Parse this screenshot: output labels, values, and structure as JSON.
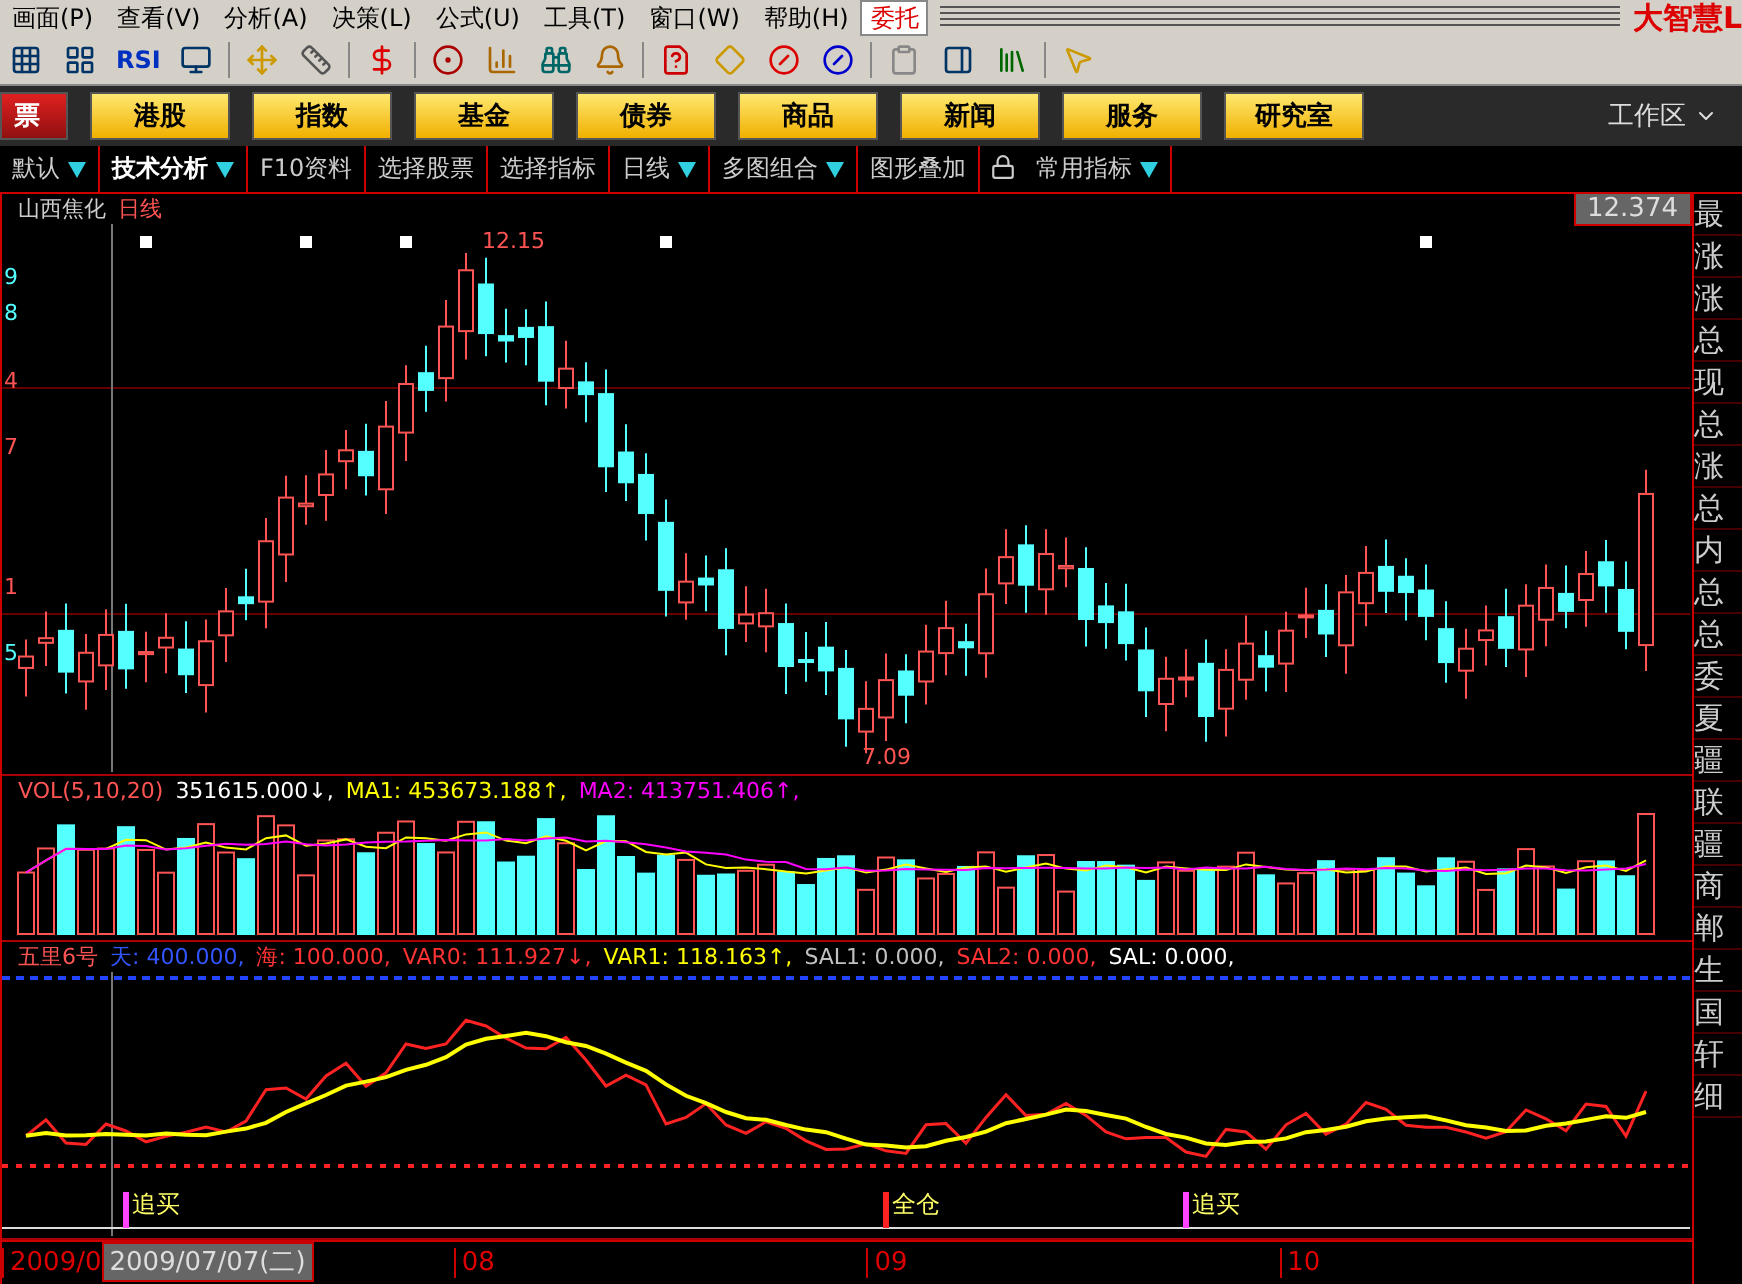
{
  "menu_bar": {
    "items": [
      "画面(P)",
      "查看(V)",
      "分析(A)",
      "决策(L)",
      "公式(U)",
      "工具(T)",
      "窗口(W)",
      "帮助(H)"
    ],
    "trade_button": "委托",
    "logo": "大智慧L"
  },
  "toolbar": {
    "rsi_label": "RSI"
  },
  "market_buttons": [
    {
      "label": "票",
      "kind": "red"
    },
    {
      "label": "港股",
      "kind": "yellow"
    },
    {
      "label": "指数",
      "kind": "yellow"
    },
    {
      "label": "基金",
      "kind": "yellow"
    },
    {
      "label": "债券",
      "kind": "yellow"
    },
    {
      "label": "商品",
      "kind": "yellow"
    },
    {
      "label": "新闻",
      "kind": "yellow"
    },
    {
      "label": "服务",
      "kind": "yellow"
    },
    {
      "label": "研究室",
      "kind": "yellow"
    }
  ],
  "workspace": {
    "label": "工作区"
  },
  "tabs": [
    {
      "label": "默认",
      "selected": false,
      "has_menu": true
    },
    {
      "label": "技术分析",
      "selected": true,
      "has_menu": true
    },
    {
      "label": "F10资料",
      "selected": false,
      "has_menu": false
    },
    {
      "label": "选择股票",
      "selected": false,
      "has_menu": false
    },
    {
      "label": "选择指标",
      "selected": false,
      "has_menu": false
    },
    {
      "label": "日线",
      "selected": false,
      "has_menu": true
    },
    {
      "label": "多图组合",
      "selected": false,
      "has_menu": true
    },
    {
      "label": "图形叠加",
      "selected": false,
      "has_menu": false
    },
    {
      "label": "常用指标",
      "selected": false,
      "has_menu": true
    }
  ],
  "price_chart": {
    "stock": "山西焦化",
    "period": "日线",
    "high_label": "12.15",
    "low_label": "7.09",
    "price_box": "12.374",
    "axis_labels": [
      {
        "text": "9",
        "color": "#54ffff"
      },
      {
        "text": "8",
        "color": "#54ffff"
      },
      {
        "text": "4",
        "color": "#ff5454"
      },
      {
        "text": "7",
        "color": "#ff5454"
      },
      {
        "text": "1",
        "color": "#ff5454"
      },
      {
        "text": "5",
        "color": "#54ffff"
      }
    ]
  },
  "volume": {
    "legend": [
      {
        "text": "VOL(5,10,20)",
        "color": "#ff5454"
      },
      {
        "text": "351615.000↓,",
        "color": "#ffffff"
      },
      {
        "text": "MA1: 453673.188↑,",
        "color": "#ffff00"
      },
      {
        "text": "MA2: 413751.406↑,",
        "color": "#ff00ff"
      }
    ]
  },
  "indicator": {
    "legend": [
      {
        "text": "五里6号",
        "color": "#ff5454"
      },
      {
        "text": "天: 400.000,",
        "color": "#3355ff"
      },
      {
        "text": "海: 100.000,",
        "color": "#ff3333"
      },
      {
        "text": "VAR0: 111.927↓,",
        "color": "#ff3333"
      },
      {
        "text": "VAR1: 118.163↑,",
        "color": "#ffff00"
      },
      {
        "text": "SAL1: 0.000,",
        "color": "#c0c0c0"
      },
      {
        "text": "SAL2: 0.000,",
        "color": "#ff3333"
      },
      {
        "text": "SAL: 0.000,",
        "color": "#ffffff"
      }
    ],
    "signals": [
      {
        "label": "追买",
        "kind": "buy"
      },
      {
        "label": "全仓",
        "kind": "full"
      },
      {
        "label": "追买",
        "kind": "buy"
      }
    ]
  },
  "date_axis": [
    {
      "text": "2009/0",
      "kind": "tick"
    },
    {
      "text": "2009/07/07(二)",
      "kind": "cursor"
    },
    {
      "text": "08",
      "kind": "tick"
    },
    {
      "text": "09",
      "kind": "tick"
    },
    {
      "text": "10",
      "kind": "tick"
    }
  ],
  "side_panel": [
    "最",
    "涨",
    "涨",
    "总",
    "现",
    "总",
    "涨",
    "总",
    "内",
    "总",
    "总",
    "委",
    "夏",
    "疆",
    "联",
    "疆",
    "商",
    "郸",
    "生",
    "国",
    "轩",
    "细"
  ]
}
